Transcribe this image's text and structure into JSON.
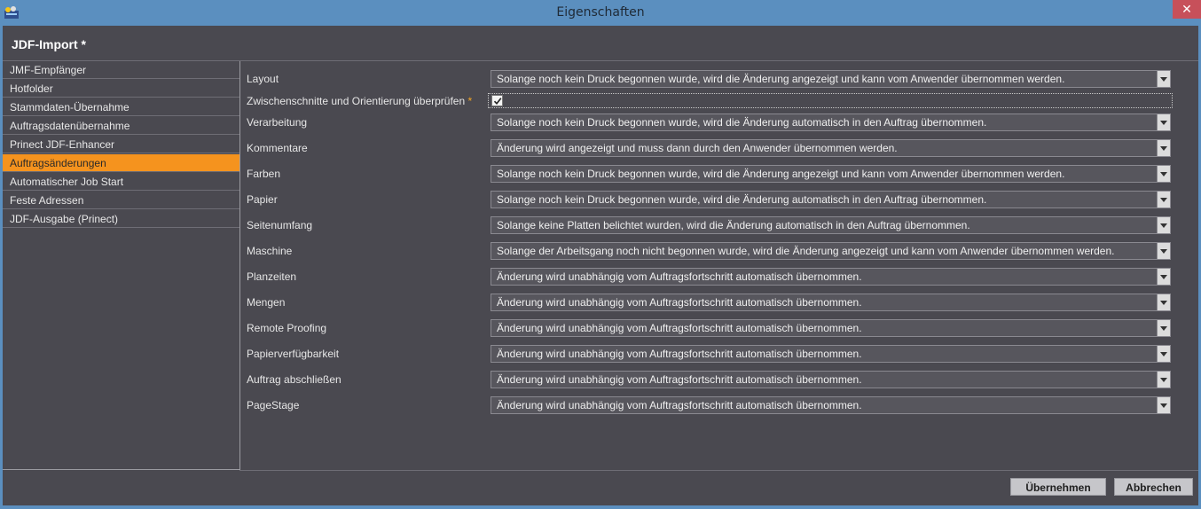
{
  "window": {
    "title": "Eigenschaften",
    "close_glyph": "✕",
    "app_icon": "app-logo-icon"
  },
  "header": {
    "title": "JDF-Import *"
  },
  "sidebar": {
    "items": [
      {
        "label": "JMF-Empfänger",
        "selected": false
      },
      {
        "label": "Hotfolder",
        "selected": false
      },
      {
        "label": "Stammdaten-Übernahme",
        "selected": false
      },
      {
        "label": "Auftragsdatenübernahme",
        "selected": false
      },
      {
        "label": "Prinect JDF-Enhancer",
        "selected": false
      },
      {
        "label": "Auftragsänderungen",
        "selected": true
      },
      {
        "label": "Automatischer Job Start",
        "selected": false
      },
      {
        "label": "Feste Adressen",
        "selected": false
      },
      {
        "label": "JDF-Ausgabe (Prinect)",
        "selected": false
      }
    ],
    "selected_color": "#f5931e"
  },
  "form": {
    "layout": {
      "label": "Layout",
      "value": "Solange noch kein Druck begonnen wurde, wird die Änderung angezeigt und kann vom Anwender übernommen werden."
    },
    "zwischen": {
      "label": "Zwischenschnitte und Orientierung überprüfen",
      "asterisk": "*",
      "checked": true
    },
    "verarbeitung": {
      "label": "Verarbeitung",
      "value": "Solange noch kein Druck begonnen wurde, wird die Änderung automatisch in den Auftrag übernommen."
    },
    "kommentare": {
      "label": "Kommentare",
      "value": "Änderung wird angezeigt und muss dann durch den Anwender übernommen werden."
    },
    "farben": {
      "label": "Farben",
      "value": "Solange noch kein Druck begonnen wurde, wird die Änderung angezeigt und kann vom Anwender übernommen werden."
    },
    "papier": {
      "label": "Papier",
      "value": "Solange noch kein Druck begonnen wurde, wird die Änderung automatisch in den Auftrag übernommen."
    },
    "seitenumfang": {
      "label": "Seitenumfang",
      "value": "Solange keine Platten belichtet wurden, wird die Änderung automatisch in den Auftrag übernommen."
    },
    "maschine": {
      "label": "Maschine",
      "value": "Solange der Arbeitsgang noch nicht begonnen wurde, wird die Änderung angezeigt und kann vom Anwender übernommen werden."
    },
    "planzeiten": {
      "label": "Planzeiten",
      "value": "Änderung wird unabhängig vom Auftragsfortschritt automatisch übernommen."
    },
    "mengen": {
      "label": "Mengen",
      "value": "Änderung wird unabhängig vom Auftragsfortschritt automatisch übernommen."
    },
    "remote": {
      "label": "Remote Proofing",
      "value": "Änderung wird unabhängig vom Auftragsfortschritt automatisch übernommen."
    },
    "papierverf": {
      "label": "Papierverfügbarkeit",
      "value": "Änderung wird unabhängig vom Auftragsfortschritt automatisch übernommen."
    },
    "abschliessen": {
      "label": "Auftrag abschließen",
      "value": "Änderung wird unabhängig vom Auftragsfortschritt automatisch übernommen."
    },
    "pagestage": {
      "label": "PageStage",
      "value": "Änderung wird unabhängig vom Auftragsfortschritt automatisch übernommen."
    }
  },
  "footer": {
    "apply_label": "Übernehmen",
    "cancel_label": "Abbrechen"
  }
}
